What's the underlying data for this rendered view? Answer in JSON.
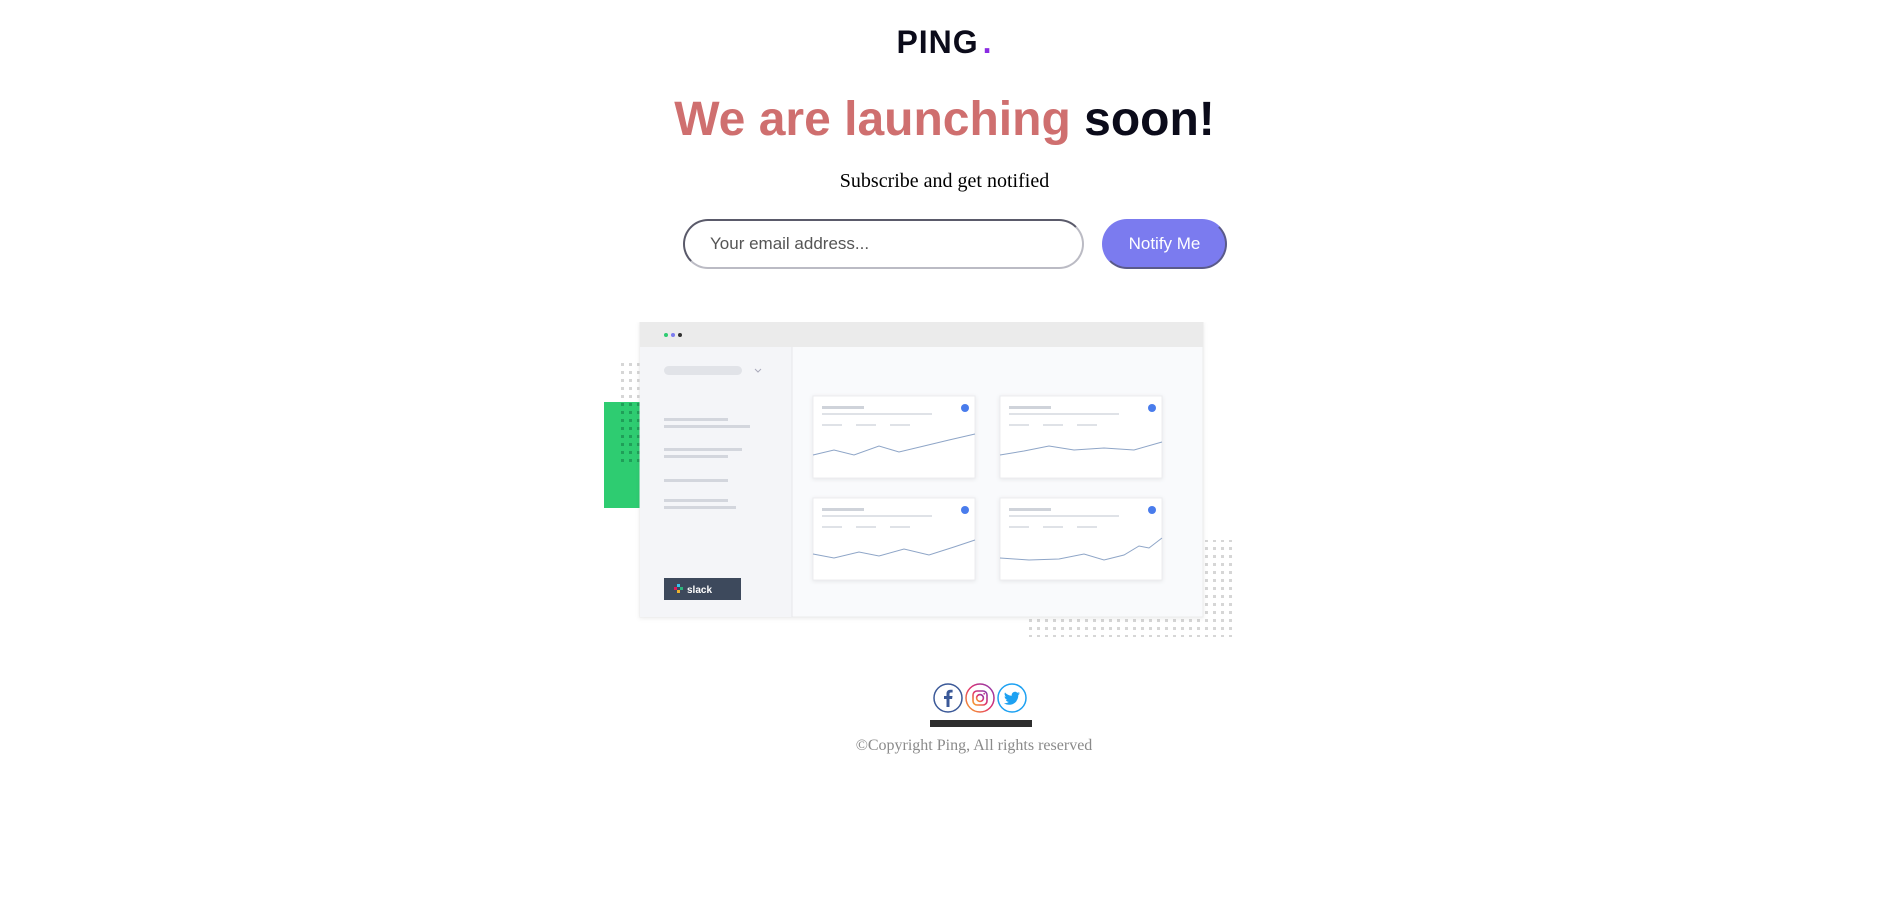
{
  "logo": {
    "text": "PING",
    "dot": "."
  },
  "headline": {
    "accent": "We are launching",
    "rest": "soon!"
  },
  "subtitle": "Subscribe and get notified",
  "form": {
    "email_placeholder": "Your email address...",
    "email_value": "",
    "button_label": "Notify Me"
  },
  "illustration": {
    "sidebar_badge": "slack"
  },
  "social": {
    "icons": [
      "facebook-icon",
      "instagram-icon",
      "twitter-icon"
    ]
  },
  "footer": {
    "copyright": "©Copyright Ping, All rights reserved"
  },
  "colors": {
    "accent_red": "#cf6f6f",
    "brand_purple": "#8a2be2",
    "button_blue": "#7b7bef",
    "green_block": "#2ecc71"
  }
}
